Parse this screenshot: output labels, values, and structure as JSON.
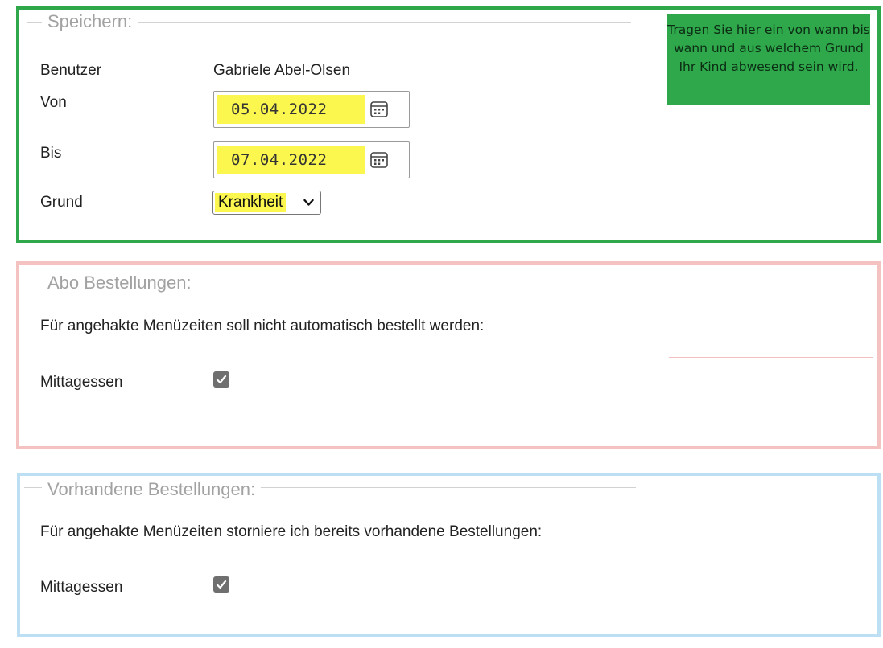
{
  "speichern": {
    "legend": "Speichern:",
    "benutzer_label": "Benutzer",
    "benutzer_value": "Gabriele Abel-Olsen",
    "von_label": "Von",
    "von_value": "05.04.2022",
    "bis_label": "Bis",
    "bis_value": "07.04.2022",
    "grund_label": "Grund",
    "grund_value": "Krankheit",
    "tooltip": "Tragen Sie hier ein von wann bis wann und aus welchem Grund Ihr Kind abwesend sein wird."
  },
  "abo": {
    "legend": "Abo Bestellungen:",
    "text": "Für angehakte Menüzeiten soll nicht automatisch bestellt werden:",
    "item_label": "Mittagessen",
    "item_checked": true
  },
  "vorhanden": {
    "legend": "Vorhandene Bestellungen:",
    "text": "Für angehakte Menüzeiten storniere ich bereits vorhandene Bestellungen:",
    "item_label": "Mittagessen",
    "item_checked": true
  },
  "colors": {
    "panel1_border": "#2ea84a",
    "panel2_border": "#f5c2c2",
    "panel3_border": "#bcdff3",
    "highlight": "#fbf74f"
  },
  "icons": [
    "calendar-icon",
    "chevron-down-icon",
    "checkmark-icon"
  ]
}
